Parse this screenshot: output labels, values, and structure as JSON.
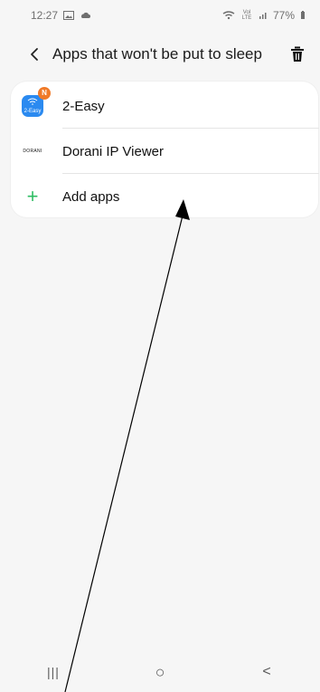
{
  "status_bar": {
    "time": "12:27",
    "battery": "77%",
    "network": "Vol LTE"
  },
  "header": {
    "title": "Apps that won't be put to sleep"
  },
  "apps": {
    "items": [
      {
        "label": "2-Easy",
        "icon": "2-easy-app-icon",
        "badge": "N",
        "icon_text": "2-Easy"
      },
      {
        "label": "Dorani IP Viewer",
        "icon": "dorani-app-icon",
        "icon_text": "DORANI"
      },
      {
        "label": "Add apps",
        "icon": "plus-icon"
      }
    ]
  },
  "nav": {
    "recent": "|||",
    "home": "○",
    "back": "<"
  },
  "colors": {
    "accent_green": "#2ebd63",
    "brand_blue": "#2b8af0",
    "badge_orange": "#f07a28",
    "background": "#f6f6f6"
  }
}
